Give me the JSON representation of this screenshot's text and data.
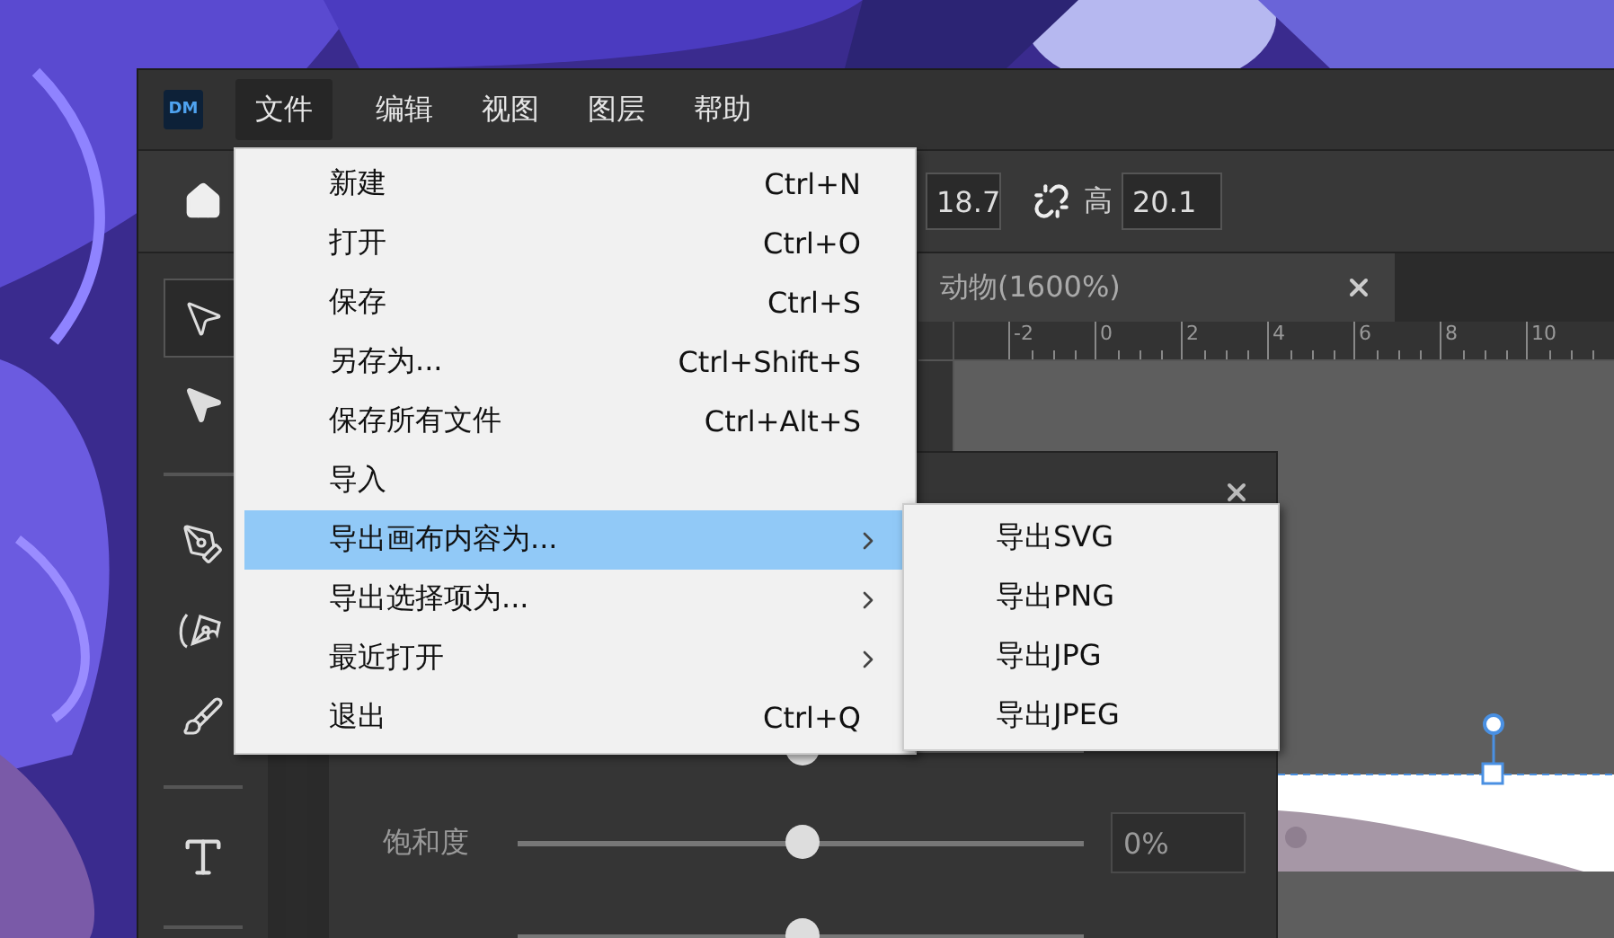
{
  "app": {
    "logo": "DM"
  },
  "menubar": [
    {
      "label": "文件",
      "selected": true
    },
    {
      "label": "编辑",
      "selected": false
    },
    {
      "label": "视图",
      "selected": false
    },
    {
      "label": "图层",
      "selected": false
    },
    {
      "label": "帮助",
      "selected": false
    }
  ],
  "toolbar": {
    "width_value": "18.7",
    "height_label": "高",
    "height_value": "20.1"
  },
  "tool_groups": [
    [
      {
        "kind": "select",
        "selected": true
      },
      {
        "kind": "direct-select",
        "selected": false
      }
    ],
    [
      {
        "kind": "pen",
        "selected": false
      },
      {
        "kind": "curve-pen",
        "selected": false
      },
      {
        "kind": "brush",
        "selected": false
      }
    ],
    [
      {
        "kind": "text",
        "selected": false
      }
    ]
  ],
  "document_tab": {
    "label": "动物(1600%)"
  },
  "ruler": [
    "-2",
    "0",
    "2",
    "4",
    "6",
    "8",
    "10"
  ],
  "panel": {
    "rows": [
      {
        "level": 0.5
      },
      {
        "label": "饱和度",
        "level": 0.5,
        "value": "0%"
      },
      {
        "level": 0.5
      }
    ]
  },
  "file_menu": [
    {
      "label": "新建",
      "shortcut": "Ctrl+N",
      "submenu": false,
      "selected": false
    },
    {
      "label": "打开",
      "shortcut": "Ctrl+O",
      "submenu": false,
      "selected": false
    },
    {
      "label": "保存",
      "shortcut": "Ctrl+S",
      "submenu": false,
      "selected": false
    },
    {
      "label": "另存为...",
      "shortcut": "Ctrl+Shift+S",
      "submenu": false,
      "selected": false
    },
    {
      "label": "保存所有文件",
      "shortcut": "Ctrl+Alt+S",
      "submenu": false,
      "selected": false
    },
    {
      "label": "导入",
      "submenu": false,
      "selected": false
    },
    {
      "label": "导出画布内容为...",
      "submenu": true,
      "selected": true
    },
    {
      "label": "导出选择项为...",
      "submenu": true,
      "selected": false
    },
    {
      "label": "最近打开",
      "submenu": true,
      "selected": false
    },
    {
      "label": "退出",
      "shortcut": "Ctrl+Q",
      "submenu": false,
      "selected": false
    }
  ],
  "export_submenu": [
    {
      "label": "导出SVG"
    },
    {
      "label": "导出PNG"
    },
    {
      "label": "导出JPG"
    },
    {
      "label": "导出JPEG"
    }
  ]
}
